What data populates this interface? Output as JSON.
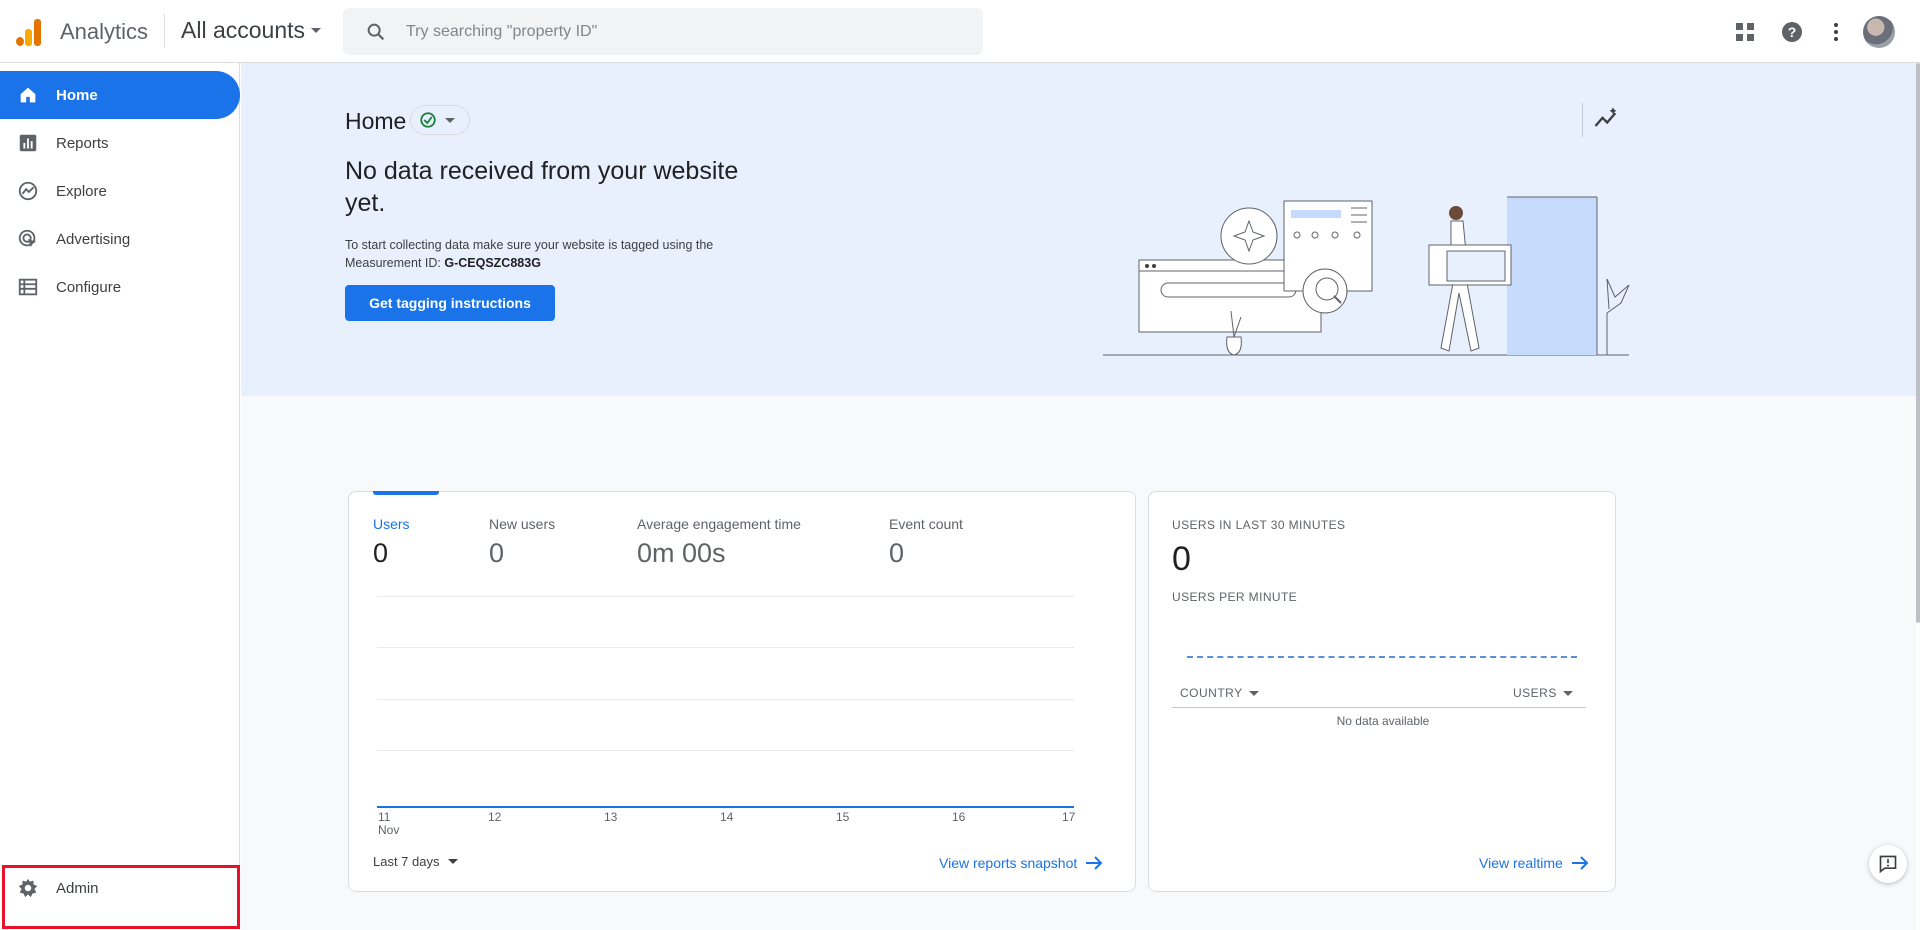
{
  "app": {
    "name": "Analytics",
    "account": "All accounts"
  },
  "search": {
    "placeholder": "Try searching \"property ID\""
  },
  "topbar_icons": [
    "apps-grid-icon",
    "help-icon",
    "more-vert-icon",
    "account-avatar"
  ],
  "sidebar": {
    "items": [
      {
        "label": "Home",
        "icon": "home-icon",
        "active": true
      },
      {
        "label": "Reports",
        "icon": "bar-chart-icon"
      },
      {
        "label": "Explore",
        "icon": "explore-icon"
      },
      {
        "label": "Advertising",
        "icon": "advertising-icon"
      },
      {
        "label": "Configure",
        "icon": "configure-icon"
      }
    ],
    "admin": {
      "label": "Admin",
      "icon": "gear-icon"
    }
  },
  "hero": {
    "title": "Home",
    "heading": "No data received from your website yet.",
    "body": "To start collecting data make sure your website is tagged using the Measurement ID:",
    "measurement_id": "G-CEQSZC883G",
    "button": "Get tagging instructions"
  },
  "overview_card": {
    "metrics": [
      {
        "label": "Users",
        "value": "0",
        "selected": true
      },
      {
        "label": "New users",
        "value": "0"
      },
      {
        "label": "Average engagement time",
        "value": "0m 00s"
      },
      {
        "label": "Event count",
        "value": "0"
      }
    ],
    "range": "Last 7 days",
    "link": "View reports snapshot"
  },
  "chart_data": {
    "type": "line",
    "x": [
      "11",
      "12",
      "13",
      "14",
      "15",
      "16",
      "17"
    ],
    "x_sublabel": "Nov",
    "series": [
      {
        "values": [
          0,
          0,
          0,
          0,
          0,
          0,
          0
        ]
      }
    ],
    "grid": true
  },
  "realtime_card": {
    "title": "USERS IN LAST 30 MINUTES",
    "value": "0",
    "subtitle": "USERS PER MINUTE",
    "col_country": "COUNTRY",
    "col_users": "USERS",
    "empty": "No data available",
    "link": "View realtime"
  },
  "colors": {
    "accent": "#1a73e8",
    "hero_bg": "#e8f0fe",
    "highlight": "#e8102a"
  }
}
